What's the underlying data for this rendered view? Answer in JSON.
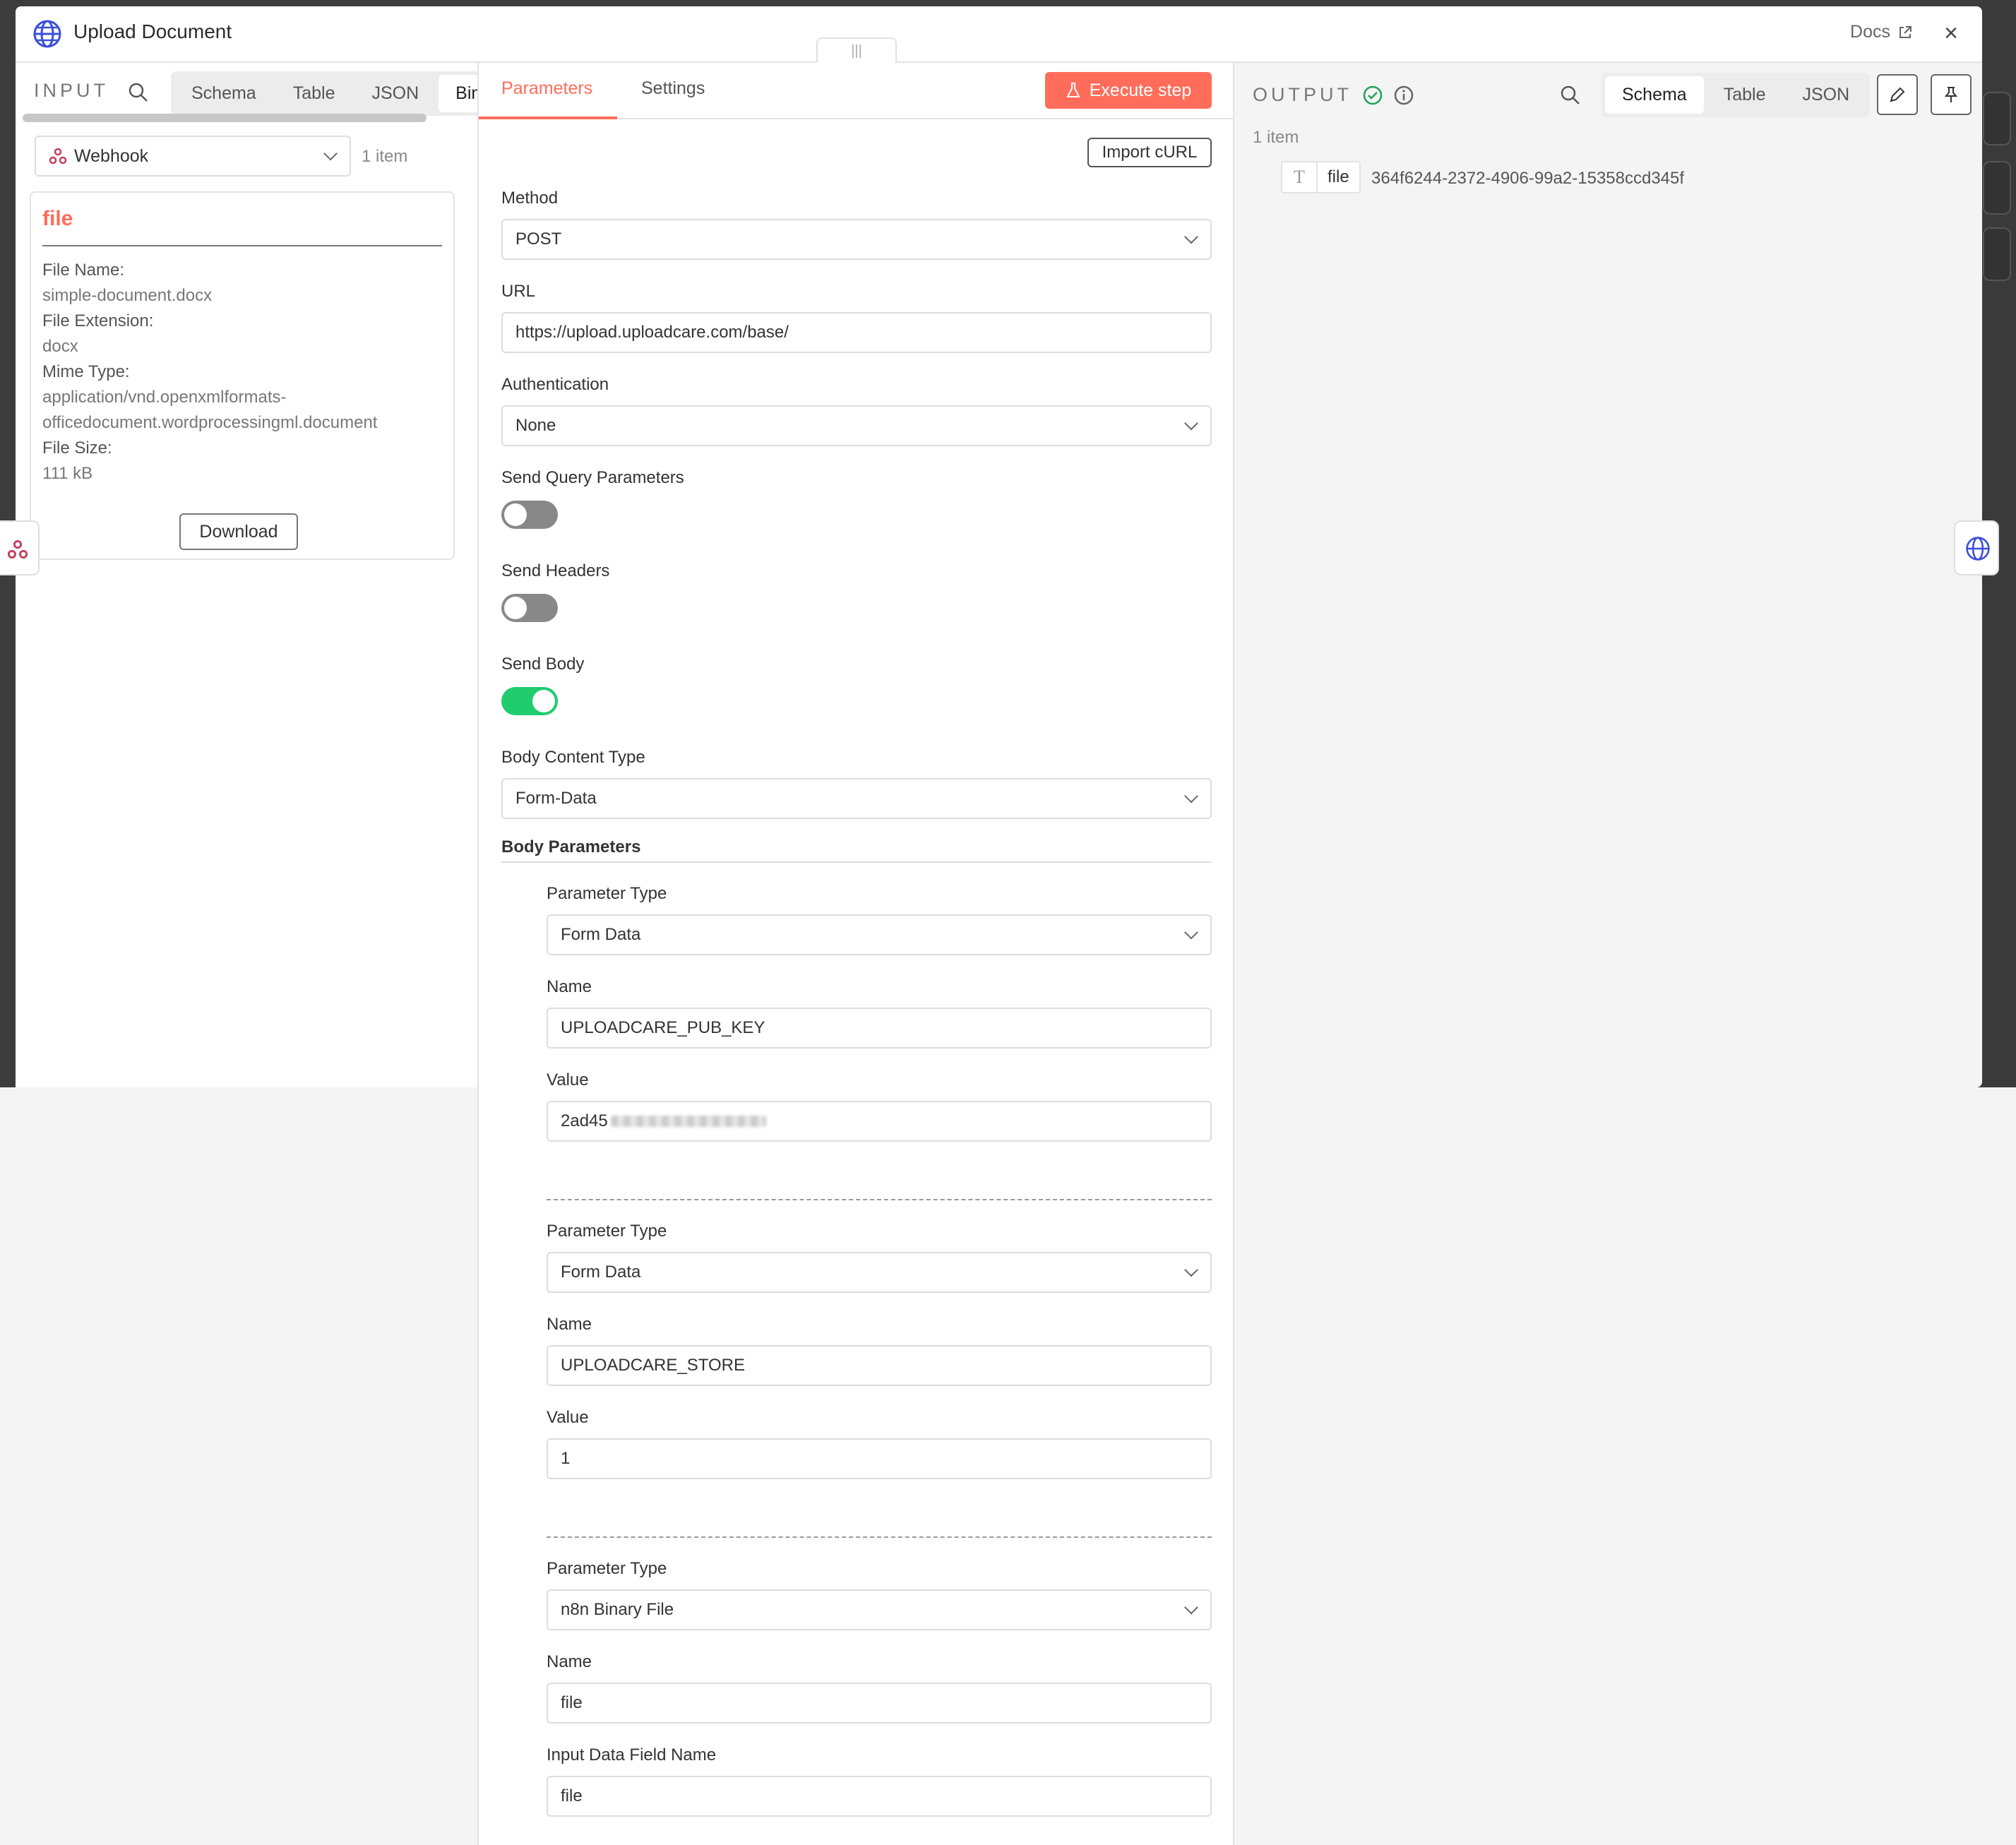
{
  "modal": {
    "title": "Upload Document",
    "docs_label": "Docs",
    "close_label": "×"
  },
  "input": {
    "label": "INPUT",
    "tabs": [
      "Schema",
      "Table",
      "JSON",
      "Bina"
    ],
    "active_tab": "Bina",
    "source_select": "Webhook",
    "item_count": "1 item",
    "file": {
      "title": "file",
      "fields": [
        {
          "key": "File Name:",
          "value": "simple-document.docx"
        },
        {
          "key": "File Extension:",
          "value": "docx"
        },
        {
          "key": "Mime Type:",
          "value": "application/vnd.openxmlformats-",
          "value2": "officedocument.wordprocessingml.document"
        },
        {
          "key": "File Size:",
          "value": "111 kB"
        }
      ],
      "download_label": "Download"
    }
  },
  "params": {
    "tabs": [
      "Parameters",
      "Settings"
    ],
    "active_tab": "Parameters",
    "execute_label": "Execute step",
    "import_curl_label": "Import cURL",
    "method": {
      "label": "Method",
      "value": "POST"
    },
    "url": {
      "label": "URL",
      "value": "https://upload.uploadcare.com/base/"
    },
    "authentication": {
      "label": "Authentication",
      "value": "None"
    },
    "send_query": {
      "label": "Send Query Parameters",
      "on": false
    },
    "send_headers": {
      "label": "Send Headers",
      "on": false
    },
    "send_body": {
      "label": "Send Body",
      "on": true
    },
    "body_content_type": {
      "label": "Body Content Type",
      "value": "Form-Data"
    },
    "body_parameters_title": "Body Parameters",
    "body_parameters": [
      {
        "type_label": "Parameter Type",
        "type": "Form Data",
        "name_label": "Name",
        "name": "UPLOADCARE_PUB_KEY",
        "value_label": "Value",
        "value": "2ad45"
      },
      {
        "type_label": "Parameter Type",
        "type": "Form Data",
        "name_label": "Name",
        "name": "UPLOADCARE_STORE",
        "value_label": "Value",
        "value": "1"
      },
      {
        "type_label": "Parameter Type",
        "type": "n8n Binary File",
        "name_label": "Name",
        "name": "file",
        "value_label": "Input Data Field Name",
        "value": "file"
      }
    ]
  },
  "output": {
    "label": "OUTPUT",
    "tabs": [
      "Schema",
      "Table",
      "JSON"
    ],
    "active_tab": "Schema",
    "item_count": "1 item",
    "schema": {
      "type_glyph": "T",
      "field": "file",
      "value": "364f6244-2372-4906-99a2-15358ccd345f"
    }
  },
  "colors": {
    "accent": "#ff6d5a",
    "success": "#1fcc6e",
    "node_blue": "#3b4fd8"
  }
}
